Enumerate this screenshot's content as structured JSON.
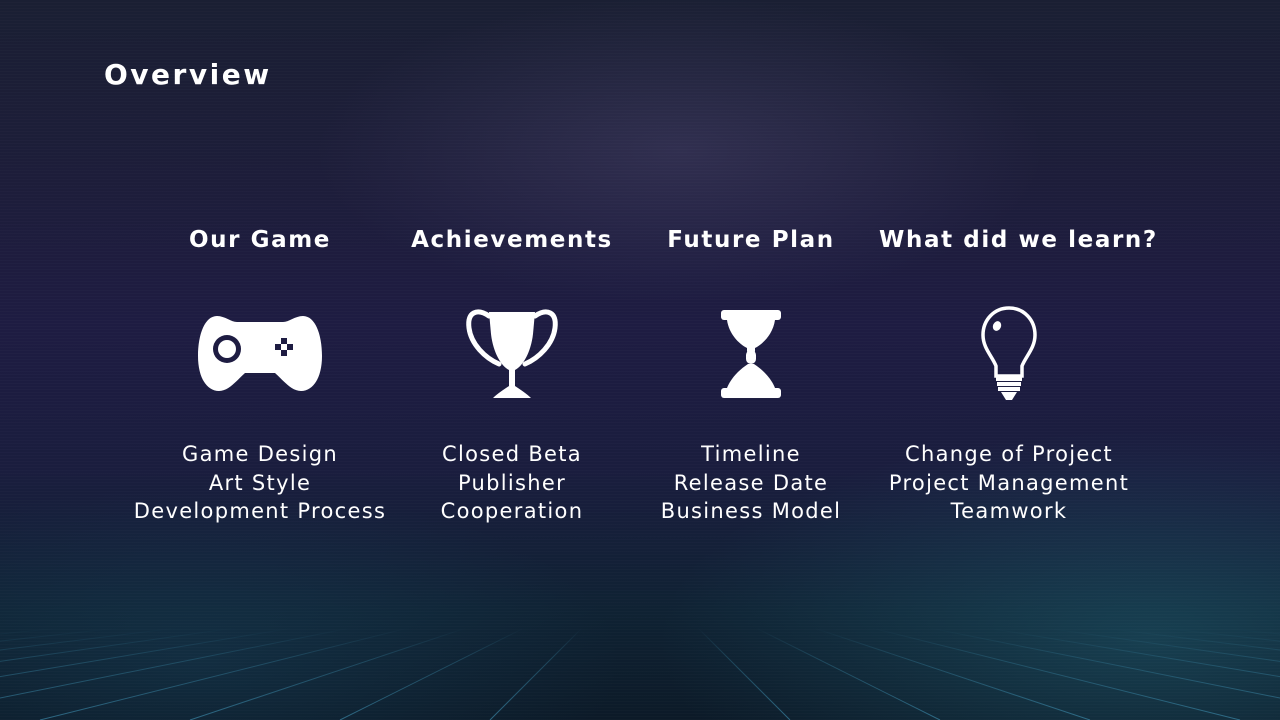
{
  "slide": {
    "title": "Overview",
    "columns": [
      {
        "heading": "Our Game",
        "icon": "gamepad-icon",
        "items": [
          "Game Design",
          "Art Style",
          "Development Process"
        ]
      },
      {
        "heading": "Achievements",
        "icon": "trophy-icon",
        "items": [
          "Closed Beta",
          "Publisher",
          "Cooperation"
        ]
      },
      {
        "heading": "Future Plan",
        "icon": "hourglass-icon",
        "items": [
          "Timeline",
          "Release Date",
          "Business Model"
        ]
      },
      {
        "heading": "What did we learn?",
        "icon": "lightbulb-icon",
        "items": [
          "Change of Project",
          "Project Management",
          "Teamwork"
        ]
      }
    ]
  },
  "colors": {
    "background_top": "#1a1f33",
    "background_mid": "#1e1c42",
    "background_bottom": "#0c1a28",
    "text": "#ffffff",
    "grid_line": "#2e6f8a"
  }
}
